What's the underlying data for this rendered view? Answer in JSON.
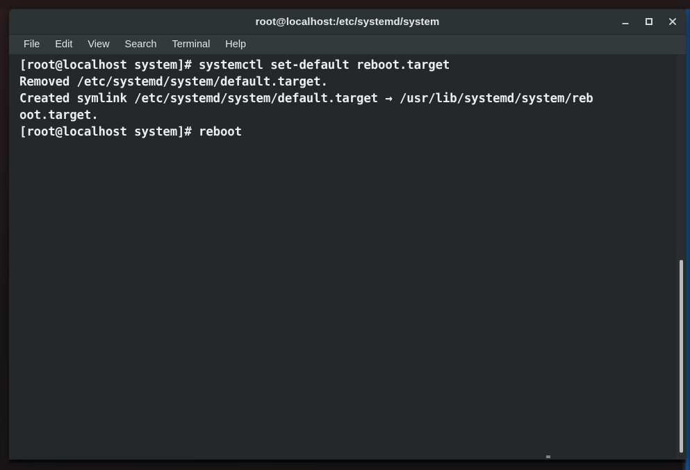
{
  "window": {
    "title": "root@localhost:/etc/systemd/system",
    "buttons": [
      {
        "name": "minimize",
        "glyph": "minimize-icon",
        "label": "_"
      },
      {
        "name": "maximize",
        "glyph": "maximize-icon",
        "label": "□"
      },
      {
        "name": "close",
        "glyph": "close-icon",
        "label": "✕"
      }
    ]
  },
  "menubar": {
    "items": [
      {
        "label": "File"
      },
      {
        "label": "Edit"
      },
      {
        "label": "View"
      },
      {
        "label": "Search"
      },
      {
        "label": "Terminal"
      },
      {
        "label": "Help"
      }
    ]
  },
  "terminal": {
    "prompt": "[root@localhost system]#",
    "lines": [
      "[root@localhost system]# systemctl set-default reboot.target",
      "Removed /etc/systemd/system/default.target.",
      "Created symlink /etc/systemd/system/default.target → /usr/lib/systemd/system/reb",
      "oot.target.",
      "[root@localhost system]# reboot"
    ],
    "text": "[root@localhost system]# systemctl set-default reboot.target\nRemoved /etc/systemd/system/default.target.\nCreated symlink /etc/systemd/system/default.target → /usr/lib/systemd/system/reb\noot.target.\n[root@localhost system]# reboot",
    "commands": [
      "systemctl set-default reboot.target",
      "reboot"
    ]
  },
  "scrollbar": {
    "position_label": "near-bottom"
  },
  "colors": {
    "terminal_background": "#24282b",
    "terminal_foreground": "#eceff0",
    "titlebar_background": "#2d3234",
    "menubar_background": "#343a3c",
    "scrollbar_thumb": "#b6babb",
    "desktop_background": "#1b1718",
    "behind_window_blue": "#14508f"
  }
}
